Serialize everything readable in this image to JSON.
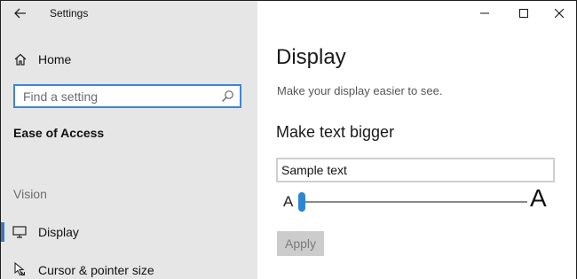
{
  "window": {
    "title": "Settings",
    "controls": [
      "minimize-icon",
      "maximize-icon",
      "close-icon"
    ]
  },
  "sidebar": {
    "home_label": "Home",
    "search": {
      "placeholder": "Find a setting",
      "value": ""
    },
    "category": "Ease of Access",
    "section": "Vision",
    "items": [
      {
        "label": "Display",
        "icon": "monitor-icon",
        "active": true
      },
      {
        "label": "Cursor & pointer size",
        "icon": "cursor-icon",
        "active": false
      }
    ]
  },
  "main": {
    "title": "Display",
    "subtitle": "Make your display easier to see.",
    "text_size": {
      "heading": "Make text bigger",
      "sample_text": "Sample text",
      "small_label": "A",
      "large_label": "A",
      "slider_fraction": 0.0,
      "apply_label": "Apply"
    }
  },
  "colors": {
    "accent": "#2d86d4",
    "sidebar_bg": "#e6e6e6",
    "disabled_button": "#cccccc"
  }
}
